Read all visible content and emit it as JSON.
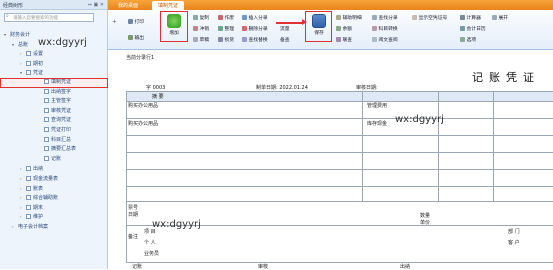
{
  "sidebar": {
    "title": "经典树形",
    "title_icons": "⇔ ▣ ✕",
    "search_placeholder": "请输入您要搜索的功能",
    "tree": [
      {
        "label": "财务会计",
        "level": 0,
        "arrow": "▾"
      },
      {
        "label": "总账",
        "level": 1,
        "arrow": "▾"
      },
      {
        "label": "设置",
        "level": 2,
        "arrow": "›"
      },
      {
        "label": "期初",
        "level": 2,
        "arrow": "›"
      },
      {
        "label": "凭证",
        "level": 2,
        "arrow": "▾"
      },
      {
        "label": "填制凭证",
        "level": 3,
        "arrow": "",
        "highlight": true
      },
      {
        "label": "出纳签字",
        "level": 3,
        "arrow": ""
      },
      {
        "label": "主管签字",
        "level": 3,
        "arrow": ""
      },
      {
        "label": "审核凭证",
        "level": 3,
        "arrow": ""
      },
      {
        "label": "查询凭证",
        "level": 3,
        "arrow": ""
      },
      {
        "label": "凭证打印",
        "level": 3,
        "arrow": ""
      },
      {
        "label": "科目汇总",
        "level": 3,
        "arrow": ""
      },
      {
        "label": "摘要汇总表",
        "level": 3,
        "arrow": ""
      },
      {
        "label": "记账",
        "level": 3,
        "arrow": ""
      },
      {
        "label": "出纳",
        "level": 2,
        "arrow": "›"
      },
      {
        "label": "现金流量表",
        "level": 2,
        "arrow": "›"
      },
      {
        "label": "账表",
        "level": 2,
        "arrow": "›"
      },
      {
        "label": "综合辅助账",
        "level": 2,
        "arrow": "›"
      },
      {
        "label": "期末",
        "level": 2,
        "arrow": "›"
      },
      {
        "label": "维护",
        "level": 2,
        "arrow": "›"
      },
      {
        "label": "电子会计档案",
        "level": 1,
        "arrow": "›"
      }
    ]
  },
  "tabs": [
    {
      "label": "我的桌面",
      "active": false
    },
    {
      "label": "填制凭证",
      "active": true
    }
  ],
  "ribbon": {
    "print": "打印",
    "output": "输出",
    "add": "增加",
    "save": "保存",
    "col3": [
      "复制",
      "冲销",
      "草稿"
    ],
    "col4": [
      "作废",
      "整理",
      "损货"
    ],
    "col5": [
      "插入分录",
      "删除分录",
      "查找替换"
    ],
    "col5b": [
      "流量",
      "备查"
    ],
    "col6": [
      "辅助明细",
      "余额",
      "联查"
    ],
    "col7": [
      "查找分录",
      "科目转换",
      "阅文查阅"
    ],
    "col8": "显示空凭证号",
    "col9": [
      "计算器",
      "会计日历",
      "选项"
    ],
    "expand": "展开"
  },
  "voucher": {
    "attach_label": "当前分录行1",
    "title": "记账凭证",
    "number": "字 0003",
    "date": "制单日期: 2022.01.24",
    "audit_date": "审核日期:",
    "header_summary": "摘 要",
    "row1": "购买办公用品",
    "row1_account": "管理费用",
    "row2": "购买办公用品",
    "row2_account": "库存现金",
    "footer_no": "票号",
    "footer_date": "日期",
    "quantity": "数量",
    "unit_price": "单价",
    "remark": "备注",
    "remark_items": [
      "项 目",
      "个 人",
      "业务员"
    ],
    "dept": "部 门",
    "customer": "客 户",
    "bottom": [
      "记账",
      "审核",
      "出纳"
    ]
  },
  "watermarks": [
    "wx:dgyyrj",
    "wx:dgyyrj",
    "wx:dgyyrj"
  ],
  "colors": {
    "highlight": "#e03030",
    "tab_orange": "#f09a2e"
  }
}
